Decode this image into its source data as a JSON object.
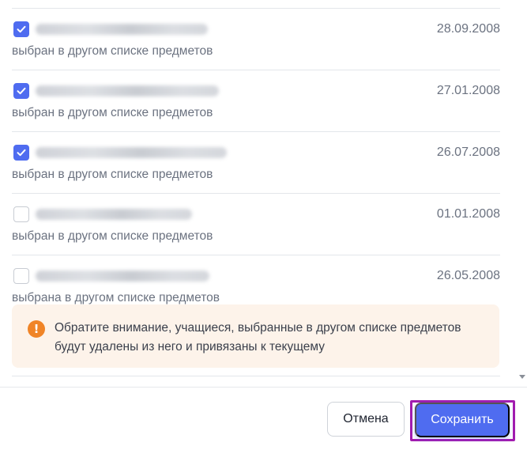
{
  "items": [
    {
      "checked": true,
      "date": "28.09.2008",
      "note": "выбран в другом списке предметов"
    },
    {
      "checked": true,
      "date": "27.01.2008",
      "note": "выбран в другом списке предметов"
    },
    {
      "checked": true,
      "date": "26.07.2008",
      "note": "выбран в другом списке предметов"
    },
    {
      "checked": false,
      "date": "01.01.2008",
      "note": "выбран в другом списке предметов"
    },
    {
      "checked": false,
      "date": "26.05.2008",
      "note": "выбрана в другом списке предметов"
    }
  ],
  "warning": {
    "icon": "exclamation-icon",
    "text": "Обратите внимание, учащиеся, выбранные в другом списке предметов будут удалены из него и привязаны к текущему"
  },
  "footer": {
    "cancel_label": "Отмена",
    "save_label": "Сохранить"
  },
  "colors": {
    "accent": "#4f6cf0",
    "warning_bg": "#fdf3ea",
    "warning_icon": "#f08427",
    "highlight": "#a21caf"
  }
}
